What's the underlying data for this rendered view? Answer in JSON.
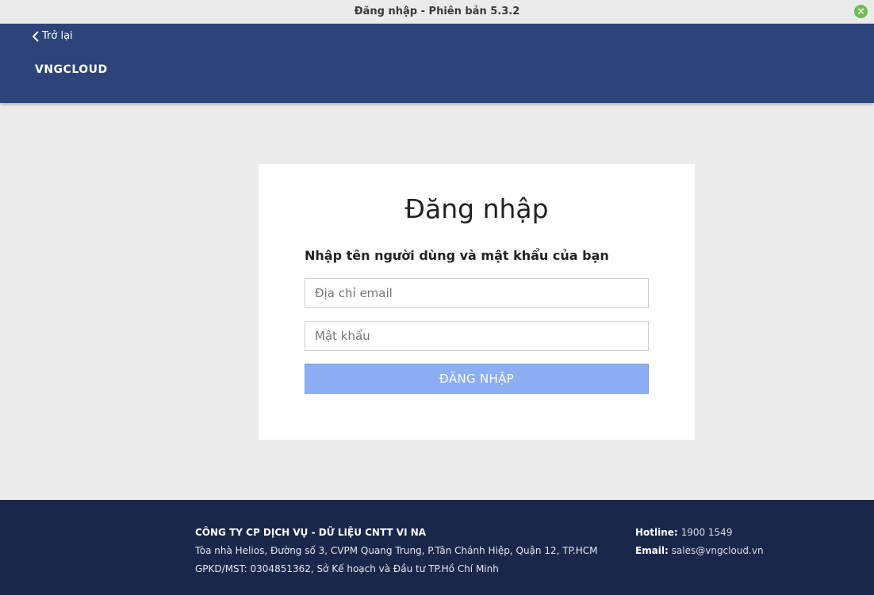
{
  "window": {
    "title": "Đăng nhập - Phiên bản 5.3.2",
    "close_icon": "close-icon"
  },
  "header": {
    "back_label": "Trở lại",
    "logo_text": "VNGCLOUD",
    "brand_color": "#2c4479"
  },
  "login": {
    "heading": "Đăng nhập",
    "subtitle": "Nhập tên người dùng và mật khẩu của bạn",
    "email_placeholder": "Địa chỉ email",
    "email_value": "",
    "password_placeholder": "Mật khẩu",
    "password_value": "",
    "submit_label": "ĐĂNG NHẬP",
    "submit_color": "#8daef2"
  },
  "footer": {
    "company": "CÔNG TY CP DỊCH VỤ - DỮ LIỆU CNTT VI NA",
    "address": "Tòa nhà Helios, Đường số 3, CVPM Quang Trung, P.Tân Chánh Hiệp, Quận 12, TP.HCM",
    "license": "GPKD/MST: 0304851362, Sở Kế hoạch và Đầu tư TP.Hồ Chí Minh",
    "hotline_label": "Hotline:",
    "hotline_value": "1900 1549",
    "email_label": "Email:",
    "email_value": "sales@vngcloud.vn",
    "background_color": "#19274a"
  }
}
